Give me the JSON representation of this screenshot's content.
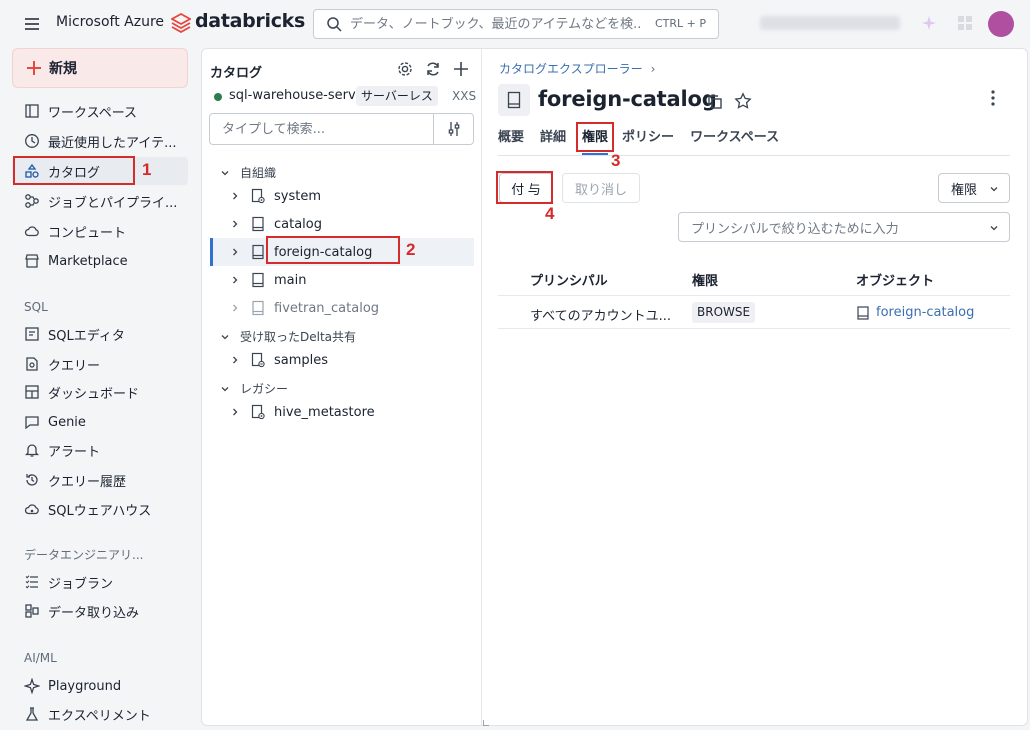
{
  "topbar": {
    "brand": "Microsoft Azure",
    "product": "databricks",
    "search_placeholder": "データ、ノートブック、最近のアイテムなどを検...",
    "search_shortcut": "CTRL + P"
  },
  "sidebar": {
    "new_label": "新規",
    "items": [
      {
        "label": "ワークスペース",
        "icon": "workspace-icon"
      },
      {
        "label": "最近使用したアイテ...",
        "icon": "clock-icon"
      },
      {
        "label": "カタログ",
        "icon": "catalog-icon",
        "active": true
      },
      {
        "label": "ジョブとパイプライ...",
        "icon": "workflow-icon"
      },
      {
        "label": "コンピュート",
        "icon": "cloud-icon"
      },
      {
        "label": "Marketplace",
        "icon": "store-icon"
      }
    ],
    "sql_section": "SQL",
    "sql_items": [
      {
        "label": "SQLエディタ",
        "icon": "editor-icon"
      },
      {
        "label": "クエリー",
        "icon": "query-icon"
      },
      {
        "label": "ダッシュボード",
        "icon": "dashboard-icon"
      },
      {
        "label": "Genie",
        "icon": "genie-icon"
      },
      {
        "label": "アラート",
        "icon": "bell-icon"
      },
      {
        "label": "クエリー履歴",
        "icon": "history-icon"
      },
      {
        "label": "SQLウェアハウス",
        "icon": "warehouse-icon"
      }
    ],
    "de_section": "データエンジニアリ...",
    "de_items": [
      {
        "label": "ジョブラン",
        "icon": "job-runs-icon"
      },
      {
        "label": "データ取り込み",
        "icon": "ingest-icon"
      }
    ],
    "ml_section": "AI/ML",
    "ml_items": [
      {
        "label": "Playground",
        "icon": "playground-icon"
      },
      {
        "label": "エクスペリメント",
        "icon": "flask-icon"
      }
    ]
  },
  "catalog_panel": {
    "title": "カタログ",
    "warehouse_name": "sql-warehouse-serv...",
    "warehouse_type": "サーバーレス",
    "warehouse_size": "XXS",
    "filter_placeholder": "タイプして検索...",
    "groups": [
      {
        "label": "自組織",
        "items": [
          "system",
          "catalog",
          "foreign-catalog",
          "main",
          "fivetran_catalog"
        ]
      },
      {
        "label": "受け取ったDelta共有",
        "items": [
          "samples"
        ]
      },
      {
        "label": "レガシー",
        "items": [
          "hive_metastore"
        ]
      }
    ],
    "selected": "foreign-catalog"
  },
  "detail": {
    "breadcrumb": "カタログエクスプローラー",
    "title": "foreign-catalog",
    "tabs": [
      "概要",
      "詳細",
      "権限",
      "ポリシー",
      "ワークスペース"
    ],
    "active_tab": "権限",
    "grant_label": "付 与",
    "revoke_label": "取り消し",
    "privileges_label": "権限",
    "principal_filter_placeholder": "プリンシパルで絞り込むために入力",
    "table": {
      "columns": [
        "プリンシパル",
        "権限",
        "オブジェクト"
      ],
      "rows": [
        {
          "principal": "すべてのアカウントユ...",
          "privilege": "BROWSE",
          "object": "foreign-catalog"
        }
      ]
    }
  },
  "annotations": {
    "n1": "1",
    "n2": "2",
    "n3": "3",
    "n4": "4",
    "color": "#d42b2b"
  }
}
